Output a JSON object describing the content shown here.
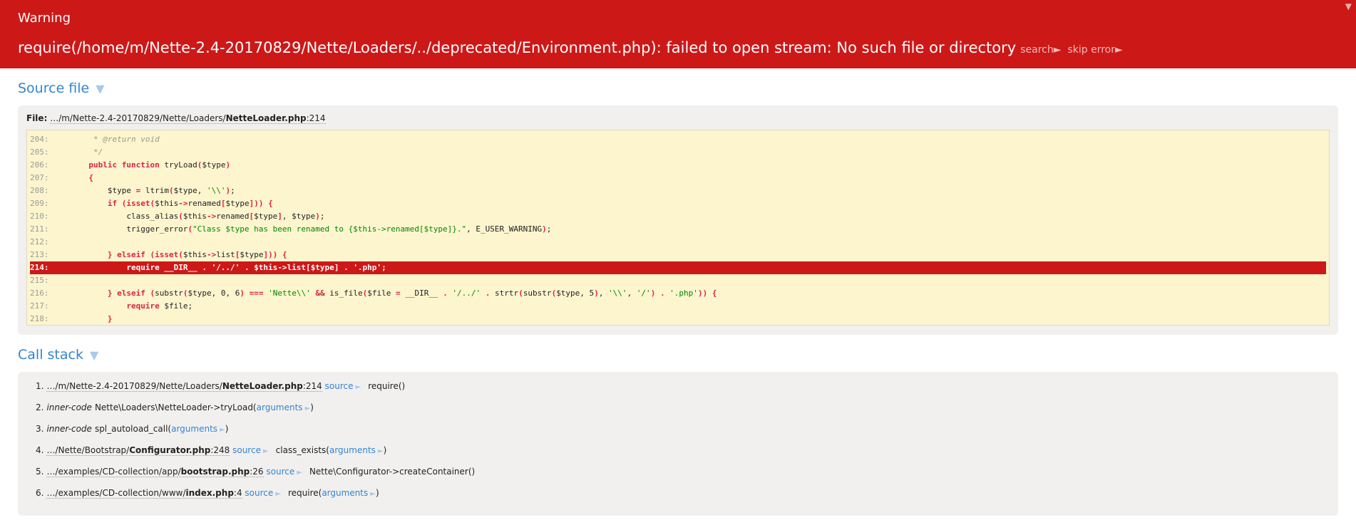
{
  "header": {
    "type": "Warning",
    "message": "require(/home/m/Nette-2.4-20170829/Nette/Loaders/../deprecated/Environment.php): failed to open stream: No such file or directory",
    "search_label": "search►",
    "skip_label": "skip error►",
    "toggle_icon": "▼"
  },
  "source": {
    "title": "Source file",
    "caret": "▼",
    "file_label": "File:",
    "file_dir": "…/m/Nette-2.4-20170829/Nette/Loaders/",
    "file_name": "NetteLoader.php",
    "file_line": ":214",
    "highlight_line": "214",
    "lines": [
      {
        "n": "204:",
        "code": "        * @return void"
      },
      {
        "n": "205:",
        "code": "        */"
      },
      {
        "n": "206:",
        "code": "       public function tryLoad($type)"
      },
      {
        "n": "207:",
        "code": "       {"
      },
      {
        "n": "208:",
        "code": "           $type = ltrim($type, '\\\\');"
      },
      {
        "n": "209:",
        "code": "           if (isset($this->renamed[$type])) {"
      },
      {
        "n": "210:",
        "code": "               class_alias($this->renamed[$type], $type);"
      },
      {
        "n": "211:",
        "code": "               trigger_error(\"Class $type has been renamed to {$this->renamed[$type]}.\", E_USER_WARNING);"
      },
      {
        "n": "212:",
        "code": ""
      },
      {
        "n": "213:",
        "code": "           } elseif (isset($this->list[$type])) {"
      },
      {
        "n": "214:",
        "code": "               require __DIR__ . '/../' . $this->list[$type] . '.php';"
      },
      {
        "n": "215:",
        "code": ""
      },
      {
        "n": "216:",
        "code": "           } elseif (substr($type, 0, 6) === 'Nette\\\\' && is_file($file = __DIR__ . '/../' . strtr(substr($type, 5), '\\\\', '/') . '.php')) {"
      },
      {
        "n": "217:",
        "code": "               require $file;"
      },
      {
        "n": "218:",
        "code": "           }"
      }
    ]
  },
  "callstack": {
    "title": "Call stack",
    "caret": "▼",
    "source_label": "source",
    "arguments_label": "arguments",
    "inner_code_label": "inner-code",
    "arrow": "►",
    "items": [
      {
        "idx": "1.",
        "dir": "…/m/Nette-2.4-20170829/Nette/Loaders/",
        "file": "NetteLoader.php",
        "line": ":214",
        "fn": "require()",
        "has_args": false
      },
      {
        "idx": "2.",
        "inner": true,
        "fn_pre": "Nette\\Loaders\\NetteLoader->tryLoad(",
        "fn_post": ")",
        "has_args": true
      },
      {
        "idx": "3.",
        "inner": true,
        "fn_pre": "spl_autoload_call(",
        "fn_post": ")",
        "has_args": true
      },
      {
        "idx": "4.",
        "dir": "…/Nette/Bootstrap/",
        "file": "Configurator.php",
        "line": ":248",
        "fn_pre": "class_exists(",
        "fn_post": ")",
        "has_args": true
      },
      {
        "idx": "5.",
        "dir": "…/examples/CD-collection/app/",
        "file": "bootstrap.php",
        "line": ":26",
        "fn": "Nette\\Configurator->createContainer()",
        "has_args": false
      },
      {
        "idx": "6.",
        "dir": "…/examples/CD-collection/www/",
        "file": "index.php",
        "line": ":4",
        "fn_pre": "require(",
        "fn_post": ")",
        "has_args": true
      }
    ]
  },
  "colors": {
    "header_bg": "#cd1818",
    "link": "#3484d2",
    "code_bg": "#fdf5ce",
    "panel_bg": "#f1f0ef"
  }
}
